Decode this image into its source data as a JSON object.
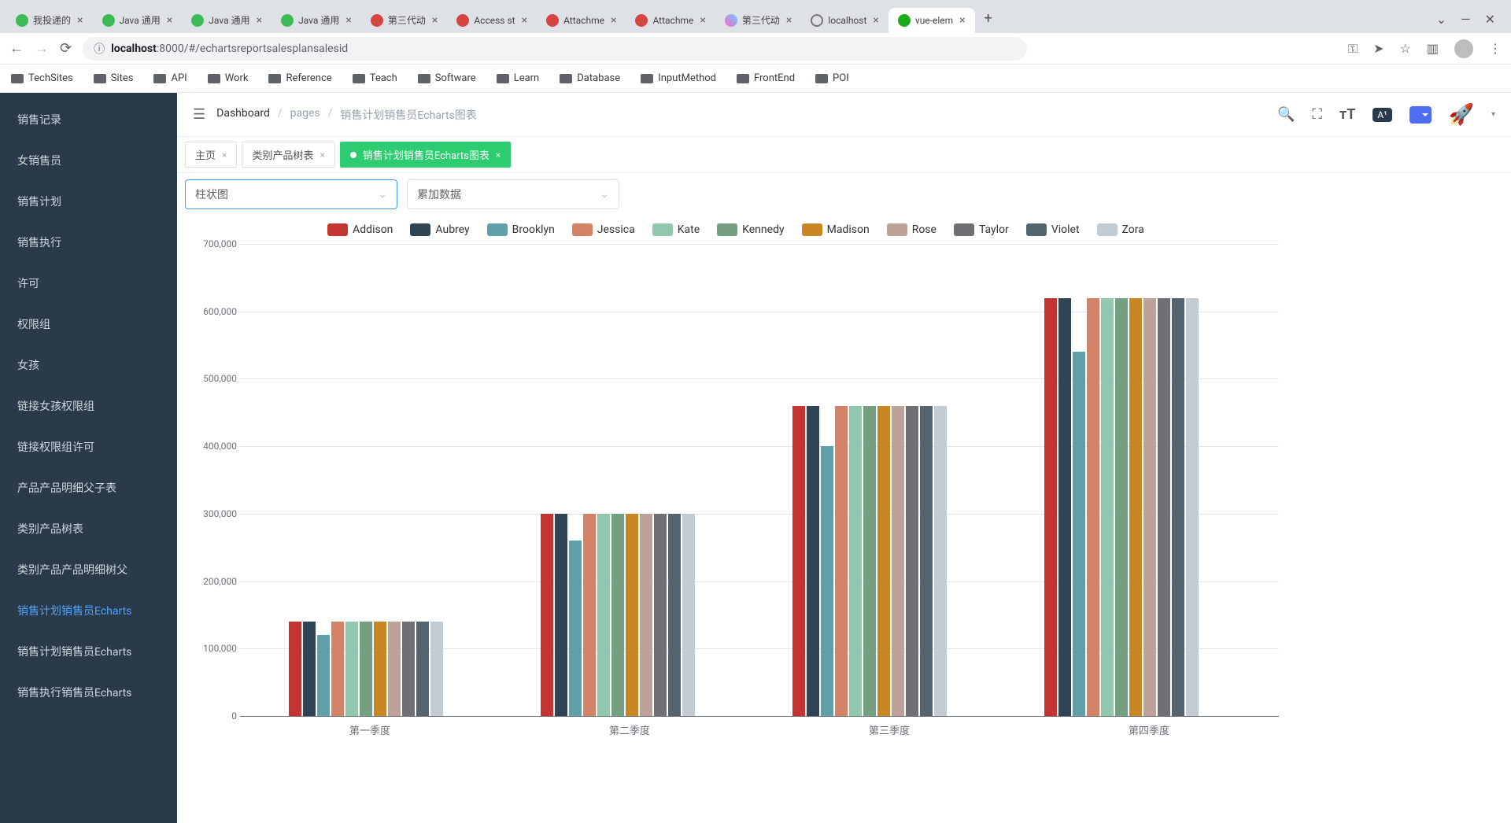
{
  "browser": {
    "tabs": [
      {
        "title": "我投递的",
        "fav": "fav-green"
      },
      {
        "title": "Java 通用",
        "fav": "fav-green"
      },
      {
        "title": "Java 通用",
        "fav": "fav-green"
      },
      {
        "title": "Java 通用",
        "fav": "fav-green"
      },
      {
        "title": "第三代动",
        "fav": "fav-red"
      },
      {
        "title": "Access st",
        "fav": "fav-red"
      },
      {
        "title": "Attachme",
        "fav": "fav-red"
      },
      {
        "title": "Attachme",
        "fav": "fav-red"
      },
      {
        "title": "第三代动",
        "fav": "fav-img"
      },
      {
        "title": "localhost",
        "fav": "fav-globe"
      },
      {
        "title": "vue-elem",
        "fav": "fav-dot",
        "active": true
      }
    ],
    "url_host": "localhost",
    "url_port_path": ":8000/#/echartsreportsalesplansalesid"
  },
  "bookmarks": [
    "TechSites",
    "Sites",
    "API",
    "Work",
    "Reference",
    "Teach",
    "Software",
    "Learn",
    "Database",
    "InputMethod",
    "FrontEnd",
    "POI"
  ],
  "sidebar": {
    "items": [
      {
        "label": "销售记录"
      },
      {
        "label": "女销售员"
      },
      {
        "label": "销售计划"
      },
      {
        "label": "销售执行"
      },
      {
        "label": "许可"
      },
      {
        "label": "权限组"
      },
      {
        "label": "女孩"
      },
      {
        "label": "链接女孩权限组"
      },
      {
        "label": "链接权限组许可"
      },
      {
        "label": "产品产品明细父子表"
      },
      {
        "label": "类别产品树表"
      },
      {
        "label": "类别产品产品明细树父"
      },
      {
        "label": "销售计划销售员Echarts",
        "active": true
      },
      {
        "label": "销售计划销售员Echarts"
      },
      {
        "label": "销售执行销售员Echarts"
      }
    ]
  },
  "breadcrumb": {
    "a": "Dashboard",
    "b": "pages",
    "c": "销售计划销售员Echarts图表"
  },
  "topbar_badge": "A¹",
  "editor_tabs": [
    {
      "label": "主页"
    },
    {
      "label": "类别产品树表"
    },
    {
      "label": "销售计划销售员Echarts图表",
      "active": true
    }
  ],
  "selects": {
    "chart_type": "柱状图",
    "data_mode": "累加数据"
  },
  "chart_data": {
    "type": "bar",
    "categories": [
      "第一季度",
      "第二季度",
      "第三季度",
      "第四季度"
    ],
    "series": [
      {
        "name": "Addison",
        "color": "#c23531",
        "values": [
          140000,
          300000,
          460000,
          620000
        ]
      },
      {
        "name": "Aubrey",
        "color": "#2f4554",
        "values": [
          140000,
          300000,
          460000,
          620000
        ]
      },
      {
        "name": "Brooklyn",
        "color": "#61a0a8",
        "values": [
          120000,
          260000,
          400000,
          540000
        ]
      },
      {
        "name": "Jessica",
        "color": "#d48265",
        "values": [
          140000,
          300000,
          460000,
          620000
        ]
      },
      {
        "name": "Kate",
        "color": "#91c7ae",
        "values": [
          140000,
          300000,
          460000,
          620000
        ]
      },
      {
        "name": "Kennedy",
        "color": "#749f83",
        "values": [
          140000,
          300000,
          460000,
          620000
        ]
      },
      {
        "name": "Madison",
        "color": "#ca8622",
        "values": [
          140000,
          300000,
          460000,
          620000
        ]
      },
      {
        "name": "Rose",
        "color": "#bda29a",
        "values": [
          140000,
          300000,
          460000,
          620000
        ]
      },
      {
        "name": "Taylor",
        "color": "#6e7074",
        "values": [
          140000,
          300000,
          460000,
          620000
        ]
      },
      {
        "name": "Violet",
        "color": "#546570",
        "values": [
          140000,
          300000,
          460000,
          620000
        ]
      },
      {
        "name": "Zora",
        "color": "#c4ccd3",
        "values": [
          140000,
          300000,
          460000,
          620000
        ]
      }
    ],
    "ylim": [
      0,
      700000
    ],
    "yticks": [
      0,
      100000,
      200000,
      300000,
      400000,
      500000,
      600000,
      700000
    ],
    "xlabel": "",
    "ylabel": "",
    "title": ""
  }
}
